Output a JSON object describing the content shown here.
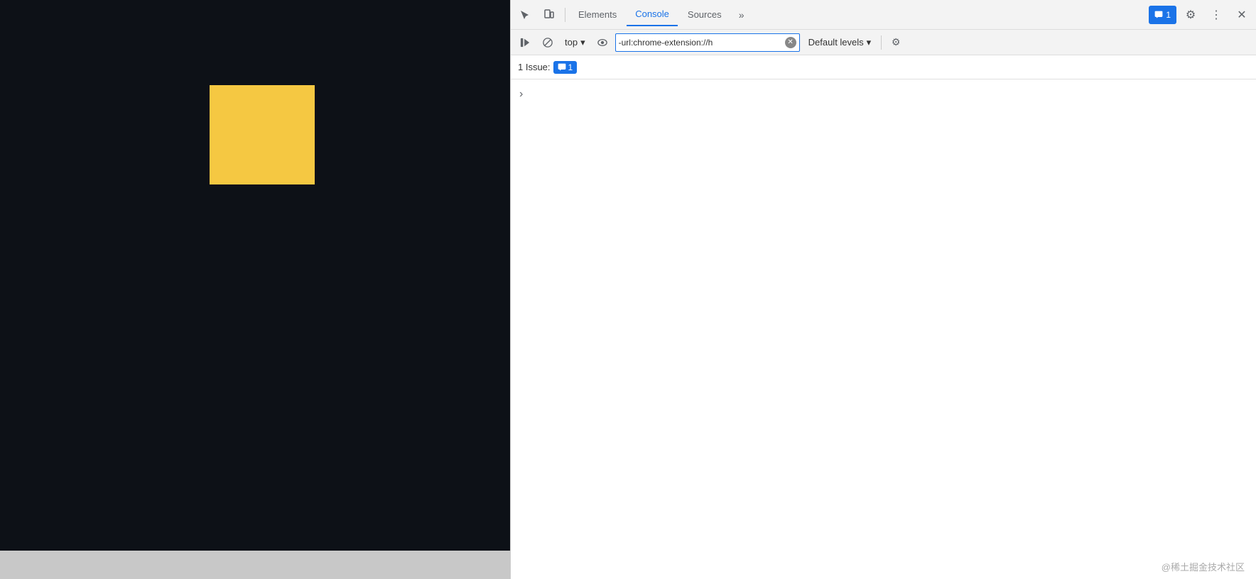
{
  "webpage": {
    "bg_color": "#0d1117",
    "square_color": "#f5c842",
    "footer_color": "#c8c8c8"
  },
  "devtools": {
    "tabs": [
      {
        "label": "Elements",
        "active": false
      },
      {
        "label": "Console",
        "active": true
      },
      {
        "label": "Sources",
        "active": false
      }
    ],
    "more_tabs_label": "»",
    "badge_count": "1",
    "settings_label": "⚙",
    "more_options_label": "⋮",
    "close_label": "✕"
  },
  "console_toolbar": {
    "run_icon": "▷",
    "block_icon": "⊘",
    "context_label": "top",
    "context_arrow": "▾",
    "eye_icon": "👁",
    "url_value": "-url:chrome-extension://h",
    "url_placeholder": "-url:chrome-extension://h",
    "levels_label": "Default levels",
    "levels_arrow": "▾",
    "settings_icon": "⚙"
  },
  "issue_bar": {
    "prefix": "1 Issue:",
    "badge_icon": "🔵",
    "badge_count": "1"
  },
  "console_content": {
    "expand_arrow": "›"
  },
  "watermark": {
    "text": "@稀土掘金技术社区"
  }
}
